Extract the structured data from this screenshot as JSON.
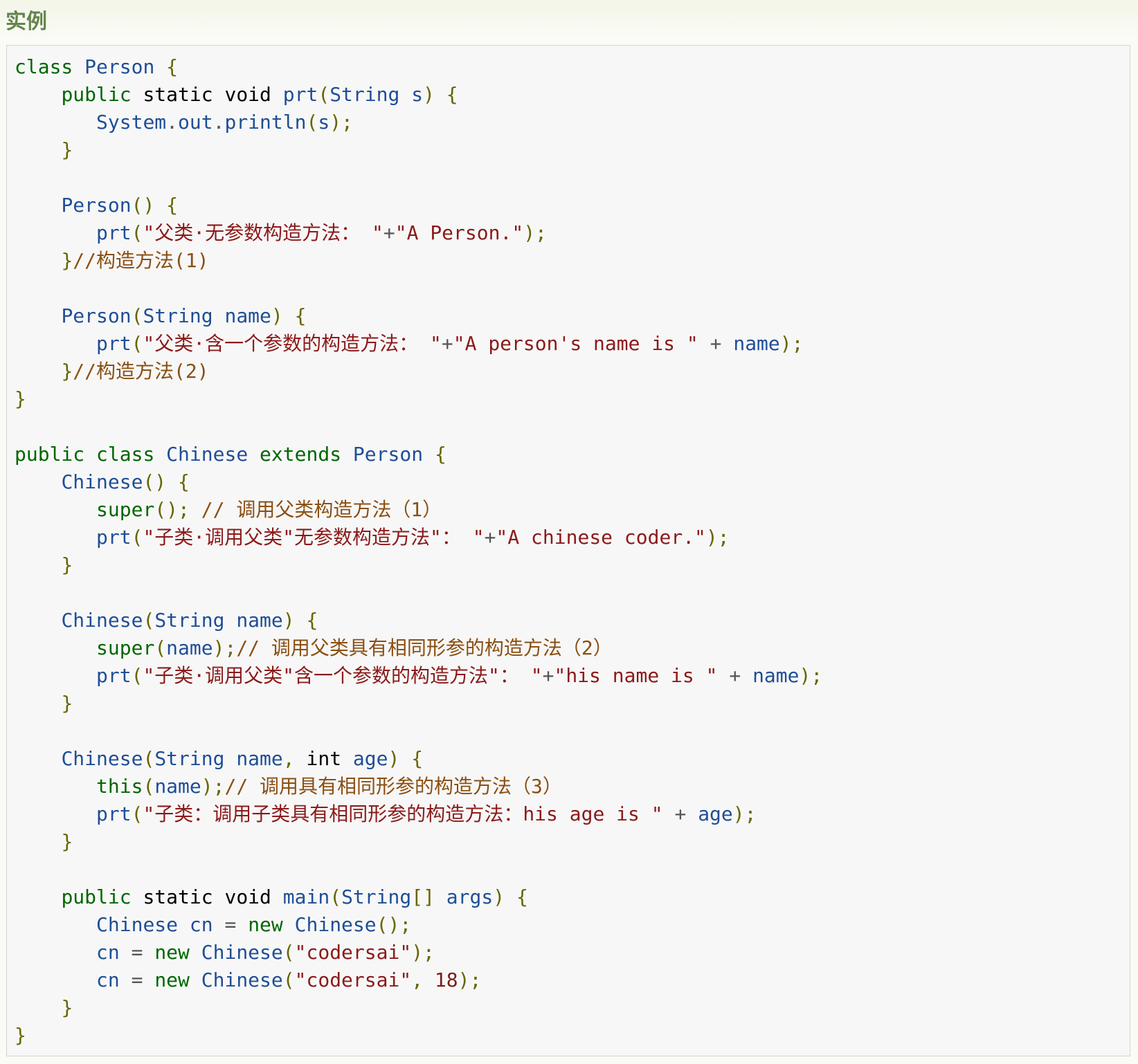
{
  "header": {
    "title": "实例"
  },
  "code": {
    "language": "java",
    "lines": [
      [
        [
          "kw",
          "class"
        ],
        [
          "pl",
          " "
        ],
        [
          "nm",
          "Person"
        ],
        [
          "pl",
          " "
        ],
        [
          "pn",
          "{"
        ]
      ],
      [
        [
          "pl",
          "    "
        ],
        [
          "kw",
          "public"
        ],
        [
          "pl",
          " "
        ],
        [
          "kd",
          "static"
        ],
        [
          "pl",
          " "
        ],
        [
          "kd",
          "void"
        ],
        [
          "pl",
          " "
        ],
        [
          "nm",
          "prt"
        ],
        [
          "pn",
          "("
        ],
        [
          "nm",
          "String"
        ],
        [
          "pl",
          " "
        ],
        [
          "nm",
          "s"
        ],
        [
          "pn",
          ")"
        ],
        [
          "pl",
          " "
        ],
        [
          "pn",
          "{"
        ]
      ],
      [
        [
          "pl",
          "       "
        ],
        [
          "nm",
          "System"
        ],
        [
          "op",
          "."
        ],
        [
          "nm",
          "out"
        ],
        [
          "op",
          "."
        ],
        [
          "nm",
          "println"
        ],
        [
          "pn",
          "("
        ],
        [
          "nm",
          "s"
        ],
        [
          "pn",
          ");"
        ]
      ],
      [
        [
          "pl",
          "    "
        ],
        [
          "pn",
          "}"
        ]
      ],
      [],
      [
        [
          "pl",
          "    "
        ],
        [
          "nm",
          "Person"
        ],
        [
          "pn",
          "()"
        ],
        [
          "pl",
          " "
        ],
        [
          "pn",
          "{"
        ]
      ],
      [
        [
          "pl",
          "       "
        ],
        [
          "nm",
          "prt"
        ],
        [
          "pn",
          "("
        ],
        [
          "st",
          "\"父类·无参数构造方法： \""
        ],
        [
          "op",
          "+"
        ],
        [
          "st",
          "\"A Person.\""
        ],
        [
          "pn",
          ");"
        ]
      ],
      [
        [
          "pl",
          "    "
        ],
        [
          "pn",
          "}"
        ],
        [
          "cm",
          "//构造方法(1)"
        ]
      ],
      [],
      [
        [
          "pl",
          "    "
        ],
        [
          "nm",
          "Person"
        ],
        [
          "pn",
          "("
        ],
        [
          "nm",
          "String"
        ],
        [
          "pl",
          " "
        ],
        [
          "nm",
          "name"
        ],
        [
          "pn",
          ")"
        ],
        [
          "pl",
          " "
        ],
        [
          "pn",
          "{"
        ]
      ],
      [
        [
          "pl",
          "       "
        ],
        [
          "nm",
          "prt"
        ],
        [
          "pn",
          "("
        ],
        [
          "st",
          "\"父类·含一个参数的构造方法： \""
        ],
        [
          "op",
          "+"
        ],
        [
          "st",
          "\"A person's name is \""
        ],
        [
          "pl",
          " "
        ],
        [
          "op",
          "+"
        ],
        [
          "pl",
          " "
        ],
        [
          "nm",
          "name"
        ],
        [
          "pn",
          ");"
        ]
      ],
      [
        [
          "pl",
          "    "
        ],
        [
          "pn",
          "}"
        ],
        [
          "cm",
          "//构造方法(2)"
        ]
      ],
      [
        [
          "pn",
          "}"
        ]
      ],
      [],
      [
        [
          "kw",
          "public"
        ],
        [
          "pl",
          " "
        ],
        [
          "kw",
          "class"
        ],
        [
          "pl",
          " "
        ],
        [
          "nm",
          "Chinese"
        ],
        [
          "pl",
          " "
        ],
        [
          "kw",
          "extends"
        ],
        [
          "pl",
          " "
        ],
        [
          "nm",
          "Person"
        ],
        [
          "pl",
          " "
        ],
        [
          "pn",
          "{"
        ]
      ],
      [
        [
          "pl",
          "    "
        ],
        [
          "nm",
          "Chinese"
        ],
        [
          "pn",
          "()"
        ],
        [
          "pl",
          " "
        ],
        [
          "pn",
          "{"
        ]
      ],
      [
        [
          "pl",
          "       "
        ],
        [
          "kw",
          "super"
        ],
        [
          "pn",
          "();"
        ],
        [
          "pl",
          " "
        ],
        [
          "cm",
          "// 调用父类构造方法（1）"
        ]
      ],
      [
        [
          "pl",
          "       "
        ],
        [
          "nm",
          "prt"
        ],
        [
          "pn",
          "("
        ],
        [
          "st",
          "\"子类·调用父类\"无参数构造方法\"： \""
        ],
        [
          "op",
          "+"
        ],
        [
          "st",
          "\"A chinese coder.\""
        ],
        [
          "pn",
          ");"
        ]
      ],
      [
        [
          "pl",
          "    "
        ],
        [
          "pn",
          "}"
        ]
      ],
      [],
      [
        [
          "pl",
          "    "
        ],
        [
          "nm",
          "Chinese"
        ],
        [
          "pn",
          "("
        ],
        [
          "nm",
          "String"
        ],
        [
          "pl",
          " "
        ],
        [
          "nm",
          "name"
        ],
        [
          "pn",
          ")"
        ],
        [
          "pl",
          " "
        ],
        [
          "pn",
          "{"
        ]
      ],
      [
        [
          "pl",
          "       "
        ],
        [
          "kw",
          "super"
        ],
        [
          "pn",
          "("
        ],
        [
          "nm",
          "name"
        ],
        [
          "pn",
          ");"
        ],
        [
          "cm",
          "// 调用父类具有相同形参的构造方法（2）"
        ]
      ],
      [
        [
          "pl",
          "       "
        ],
        [
          "nm",
          "prt"
        ],
        [
          "pn",
          "("
        ],
        [
          "st",
          "\"子类·调用父类\"含一个参数的构造方法\"： \""
        ],
        [
          "op",
          "+"
        ],
        [
          "st",
          "\"his name is \""
        ],
        [
          "pl",
          " "
        ],
        [
          "op",
          "+"
        ],
        [
          "pl",
          " "
        ],
        [
          "nm",
          "name"
        ],
        [
          "pn",
          ");"
        ]
      ],
      [
        [
          "pl",
          "    "
        ],
        [
          "pn",
          "}"
        ]
      ],
      [],
      [
        [
          "pl",
          "    "
        ],
        [
          "nm",
          "Chinese"
        ],
        [
          "pn",
          "("
        ],
        [
          "nm",
          "String"
        ],
        [
          "pl",
          " "
        ],
        [
          "nm",
          "name"
        ],
        [
          "pn",
          ","
        ],
        [
          "pl",
          " "
        ],
        [
          "kd",
          "int"
        ],
        [
          "pl",
          " "
        ],
        [
          "nm",
          "age"
        ],
        [
          "pn",
          ")"
        ],
        [
          "pl",
          " "
        ],
        [
          "pn",
          "{"
        ]
      ],
      [
        [
          "pl",
          "       "
        ],
        [
          "kw",
          "this"
        ],
        [
          "pn",
          "("
        ],
        [
          "nm",
          "name"
        ],
        [
          "pn",
          ");"
        ],
        [
          "cm",
          "// 调用具有相同形参的构造方法（3）"
        ]
      ],
      [
        [
          "pl",
          "       "
        ],
        [
          "nm",
          "prt"
        ],
        [
          "pn",
          "("
        ],
        [
          "st",
          "\"子类：调用子类具有相同形参的构造方法：his age is \""
        ],
        [
          "pl",
          " "
        ],
        [
          "op",
          "+"
        ],
        [
          "pl",
          " "
        ],
        [
          "nm",
          "age"
        ],
        [
          "pn",
          ");"
        ]
      ],
      [
        [
          "pl",
          "    "
        ],
        [
          "pn",
          "}"
        ]
      ],
      [],
      [
        [
          "pl",
          "    "
        ],
        [
          "kw",
          "public"
        ],
        [
          "pl",
          " "
        ],
        [
          "kd",
          "static"
        ],
        [
          "pl",
          " "
        ],
        [
          "kd",
          "void"
        ],
        [
          "pl",
          " "
        ],
        [
          "nm",
          "main"
        ],
        [
          "pn",
          "("
        ],
        [
          "nm",
          "String"
        ],
        [
          "pn",
          "[]"
        ],
        [
          "pl",
          " "
        ],
        [
          "nm",
          "args"
        ],
        [
          "pn",
          ")"
        ],
        [
          "pl",
          " "
        ],
        [
          "pn",
          "{"
        ]
      ],
      [
        [
          "pl",
          "       "
        ],
        [
          "nm",
          "Chinese"
        ],
        [
          "pl",
          " "
        ],
        [
          "nm",
          "cn"
        ],
        [
          "pl",
          " "
        ],
        [
          "op",
          "="
        ],
        [
          "pl",
          " "
        ],
        [
          "kw",
          "new"
        ],
        [
          "pl",
          " "
        ],
        [
          "nm",
          "Chinese"
        ],
        [
          "pn",
          "();"
        ]
      ],
      [
        [
          "pl",
          "       "
        ],
        [
          "nm",
          "cn"
        ],
        [
          "pl",
          " "
        ],
        [
          "op",
          "="
        ],
        [
          "pl",
          " "
        ],
        [
          "kw",
          "new"
        ],
        [
          "pl",
          " "
        ],
        [
          "nm",
          "Chinese"
        ],
        [
          "pn",
          "("
        ],
        [
          "st",
          "\"codersai\""
        ],
        [
          "pn",
          ");"
        ]
      ],
      [
        [
          "pl",
          "       "
        ],
        [
          "nm",
          "cn"
        ],
        [
          "pl",
          " "
        ],
        [
          "op",
          "="
        ],
        [
          "pl",
          " "
        ],
        [
          "kw",
          "new"
        ],
        [
          "pl",
          " "
        ],
        [
          "nm",
          "Chinese"
        ],
        [
          "pn",
          "("
        ],
        [
          "st",
          "\"codersai\""
        ],
        [
          "pn",
          ","
        ],
        [
          "pl",
          " "
        ],
        [
          "nb",
          "18"
        ],
        [
          "pn",
          ");"
        ]
      ],
      [
        [
          "pl",
          "    "
        ],
        [
          "pn",
          "}"
        ]
      ],
      [
        [
          "pn",
          "}"
        ]
      ]
    ]
  }
}
